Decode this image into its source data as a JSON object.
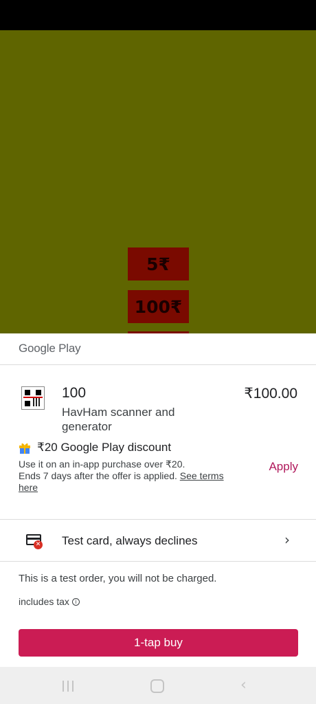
{
  "app": {
    "donate_buttons": [
      "5₹",
      "100₹"
    ],
    "background_color": "#5f6500",
    "button_color": "#7a0a00"
  },
  "sheet": {
    "brand": "Google Play",
    "product": {
      "title": "100",
      "app_name": "HavHam scanner and generator",
      "price": "₹100.00",
      "icon": "qr-barcode-icon"
    },
    "promo": {
      "icon": "gift-icon",
      "title": "₹20 Google Play discount",
      "desc_line1": "Use it on an in-app purchase over ₹20.",
      "desc_line2": "Ends 7 days after the offer is applied.",
      "link": "See terms here",
      "apply_label": "Apply"
    },
    "payment": {
      "icon": "credit-card-error-icon",
      "badge": "✕",
      "label": "Test card, always declines",
      "chevron": "›"
    },
    "test_note": "This is a test order, you will not be charged.",
    "tax_label": "includes tax",
    "tax_info_glyph": "i",
    "buy_label": "1-tap buy",
    "accent_color": "#cb1c54"
  },
  "nav": {
    "back_glyph": "‹"
  }
}
